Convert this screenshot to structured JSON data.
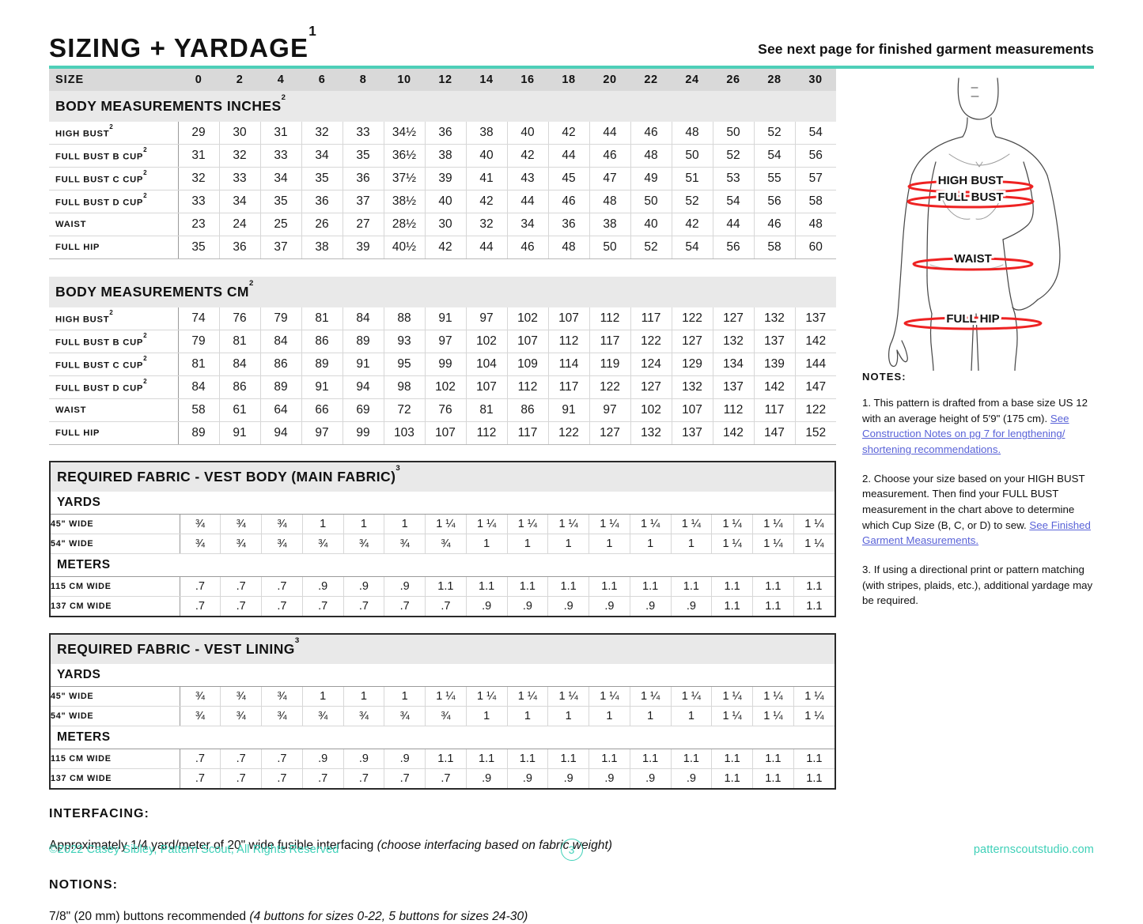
{
  "header": {
    "title": "SIZING + YARDAGE",
    "title_sup": "1",
    "note": "See next page for finished garment measurements"
  },
  "size_row": {
    "label": "SIZE",
    "sizes": [
      "0",
      "2",
      "4",
      "6",
      "8",
      "10",
      "12",
      "14",
      "16",
      "18",
      "20",
      "22",
      "24",
      "26",
      "28",
      "30"
    ]
  },
  "sections": {
    "inches": {
      "heading": "BODY MEASUREMENTS INCHES",
      "heading_sup": "2",
      "rows": [
        {
          "label": "HIGH BUST",
          "sup": "2",
          "values": [
            "29",
            "30",
            "31",
            "32",
            "33",
            "34½",
            "36",
            "38",
            "40",
            "42",
            "44",
            "46",
            "48",
            "50",
            "52",
            "54"
          ]
        },
        {
          "label": "FULL BUST B CUP",
          "sup": "2",
          "values": [
            "31",
            "32",
            "33",
            "34",
            "35",
            "36½",
            "38",
            "40",
            "42",
            "44",
            "46",
            "48",
            "50",
            "52",
            "54",
            "56"
          ]
        },
        {
          "label": "FULL BUST C CUP",
          "sup": "2",
          "values": [
            "32",
            "33",
            "34",
            "35",
            "36",
            "37½",
            "39",
            "41",
            "43",
            "45",
            "47",
            "49",
            "51",
            "53",
            "55",
            "57"
          ]
        },
        {
          "label": "FULL BUST D CUP",
          "sup": "2",
          "values": [
            "33",
            "34",
            "35",
            "36",
            "37",
            "38½",
            "40",
            "42",
            "44",
            "46",
            "48",
            "50",
            "52",
            "54",
            "56",
            "58"
          ]
        },
        {
          "label": "WAIST",
          "sup": "",
          "values": [
            "23",
            "24",
            "25",
            "26",
            "27",
            "28½",
            "30",
            "32",
            "34",
            "36",
            "38",
            "40",
            "42",
            "44",
            "46",
            "48"
          ]
        },
        {
          "label": "FULL HIP",
          "sup": "",
          "values": [
            "35",
            "36",
            "37",
            "38",
            "39",
            "40½",
            "42",
            "44",
            "46",
            "48",
            "50",
            "52",
            "54",
            "56",
            "58",
            "60"
          ]
        }
      ]
    },
    "cm": {
      "heading": "BODY MEASUREMENTS CM",
      "heading_sup": "2",
      "rows": [
        {
          "label": "HIGH BUST",
          "sup": "2",
          "values": [
            "74",
            "76",
            "79",
            "81",
            "84",
            "88",
            "91",
            "97",
            "102",
            "107",
            "112",
            "117",
            "122",
            "127",
            "132",
            "137"
          ]
        },
        {
          "label": "FULL BUST B CUP",
          "sup": "2",
          "values": [
            "79",
            "81",
            "84",
            "86",
            "89",
            "93",
            "97",
            "102",
            "107",
            "112",
            "117",
            "122",
            "127",
            "132",
            "137",
            "142"
          ]
        },
        {
          "label": "FULL BUST C CUP",
          "sup": "2",
          "values": [
            "81",
            "84",
            "86",
            "89",
            "91",
            "95",
            "99",
            "104",
            "109",
            "114",
            "119",
            "124",
            "129",
            "134",
            "139",
            "144"
          ]
        },
        {
          "label": "FULL BUST D CUP",
          "sup": "2",
          "values": [
            "84",
            "86",
            "89",
            "91",
            "94",
            "98",
            "102",
            "107",
            "112",
            "117",
            "122",
            "127",
            "132",
            "137",
            "142",
            "147"
          ]
        },
        {
          "label": "WAIST",
          "sup": "",
          "values": [
            "58",
            "61",
            "64",
            "66",
            "69",
            "72",
            "76",
            "81",
            "86",
            "91",
            "97",
            "102",
            "107",
            "112",
            "117",
            "122"
          ]
        },
        {
          "label": "FULL HIP",
          "sup": "",
          "values": [
            "89",
            "91",
            "94",
            "97",
            "99",
            "103",
            "107",
            "112",
            "117",
            "122",
            "127",
            "132",
            "137",
            "142",
            "147",
            "152"
          ]
        }
      ]
    },
    "vest_body": {
      "heading": "REQUIRED FABRIC - VEST BODY (MAIN FABRIC)",
      "heading_sup": "3",
      "yards_label": "YARDS",
      "meters_label": "METERS",
      "rows": [
        {
          "label": "45\" WIDE",
          "values": [
            "¾",
            "¾",
            "¾",
            "1",
            "1",
            "1",
            "1 ¼",
            "1 ¼",
            "1 ¼",
            "1 ¼",
            "1 ¼",
            "1 ¼",
            "1 ¼",
            "1 ¼",
            "1 ¼",
            "1 ¼"
          ]
        },
        {
          "label": "54\" WIDE",
          "values": [
            "¾",
            "¾",
            "¾",
            "¾",
            "¾",
            "¾",
            "¾",
            "1",
            "1",
            "1",
            "1",
            "1",
            "1",
            "1 ¼",
            "1 ¼",
            "1 ¼"
          ]
        },
        {
          "label": "115 CM WIDE",
          "values": [
            ".7",
            ".7",
            ".7",
            ".9",
            ".9",
            ".9",
            "1.1",
            "1.1",
            "1.1",
            "1.1",
            "1.1",
            "1.1",
            "1.1",
            "1.1",
            "1.1",
            "1.1"
          ]
        },
        {
          "label": "137 CM WIDE",
          "values": [
            ".7",
            ".7",
            ".7",
            ".7",
            ".7",
            ".7",
            ".7",
            ".9",
            ".9",
            ".9",
            ".9",
            ".9",
            ".9",
            "1.1",
            "1.1",
            "1.1"
          ]
        }
      ]
    },
    "vest_lining": {
      "heading": "REQUIRED FABRIC - VEST LINING",
      "heading_sup": "3",
      "yards_label": "YARDS",
      "meters_label": "METERS",
      "rows": [
        {
          "label": "45\" WIDE",
          "values": [
            "¾",
            "¾",
            "¾",
            "1",
            "1",
            "1",
            "1 ¼",
            "1 ¼",
            "1 ¼",
            "1 ¼",
            "1 ¼",
            "1 ¼",
            "1 ¼",
            "1 ¼",
            "1 ¼",
            "1 ¼"
          ]
        },
        {
          "label": "54\" WIDE",
          "values": [
            "¾",
            "¾",
            "¾",
            "¾",
            "¾",
            "¾",
            "¾",
            "1",
            "1",
            "1",
            "1",
            "1",
            "1",
            "1 ¼",
            "1 ¼",
            "1 ¼"
          ]
        },
        {
          "label": "115 CM WIDE",
          "values": [
            ".7",
            ".7",
            ".7",
            ".9",
            ".9",
            ".9",
            "1.1",
            "1.1",
            "1.1",
            "1.1",
            "1.1",
            "1.1",
            "1.1",
            "1.1",
            "1.1",
            "1.1"
          ]
        },
        {
          "label": "137 CM WIDE",
          "values": [
            ".7",
            ".7",
            ".7",
            ".7",
            ".7",
            ".7",
            ".7",
            ".9",
            ".9",
            ".9",
            ".9",
            ".9",
            ".9",
            "1.1",
            "1.1",
            "1.1"
          ]
        }
      ]
    }
  },
  "figure": {
    "labels": [
      "HIGH BUST",
      "FULL BUST",
      "WAIST",
      "FULL HIP"
    ],
    "band_color": "#ee2222",
    "outline_color": "#444444"
  },
  "notes": {
    "title": "NOTES:",
    "items": [
      {
        "plain_1": "1. This pattern is drafted from a base size US 12 with an average height of 5'9\" (175 cm). ",
        "link": "See Construction Notes on pg 7 for lengthening/ shortening recommendations.",
        "plain_2": ""
      },
      {
        "plain_1": "2. Choose your size based on your HIGH BUST measurement. Then find your FULL BUST measurement in the chart above to determine which Cup Size (B, C, or D) to sew. ",
        "link": "See Finished Garment Measurements.",
        "plain_2": ""
      },
      {
        "plain_1": "3. If using a directional print or pattern matching (with stripes, plaids, etc.), additional yardage may be required.",
        "link": "",
        "plain_2": ""
      }
    ]
  },
  "interfacing": {
    "title": "INTERFACING:",
    "text_plain": "Approximately 1/4 yard/meter of 20\" wide fusible interfacing ",
    "text_italic": "(choose interfacing based on fabric weight)"
  },
  "notions": {
    "title": "NOTIONS:",
    "text_plain": "7/8\" (20 mm) buttons recommended ",
    "text_italic": "(4 buttons for sizes 0-22, 5 buttons for sizes 24-30)"
  },
  "footer": {
    "copyright": "©2022 Casey Sibley, Pattern Scout, All Rights Reserved",
    "page_number": "3",
    "website": "patternscoutstudio.com"
  },
  "colors": {
    "teal": "#3fd0b8",
    "teal_rule": "#4ecfb8",
    "link": "#5a63d8",
    "section_bg": "#e9e9e9",
    "size_bg": "#d9d9d9"
  }
}
